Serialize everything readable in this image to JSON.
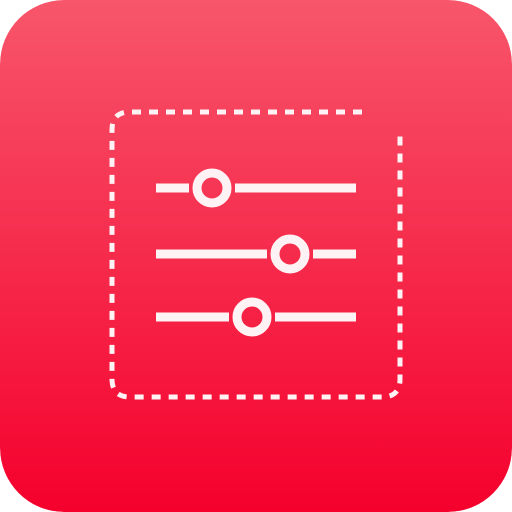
{
  "icon": {
    "name": "sliders-settings-app-icon",
    "glyph": "sliders-icon",
    "frame": "dashed-square-frame",
    "colors": {
      "background_top": "#f7566b",
      "background_bottom": "#f5002d",
      "foreground": "#fff2f4"
    },
    "sliders": [
      {
        "name": "slider-1",
        "level": 0.28
      },
      {
        "name": "slider-2",
        "level": 0.67
      },
      {
        "name": "slider-3",
        "level": 0.48
      }
    ]
  }
}
